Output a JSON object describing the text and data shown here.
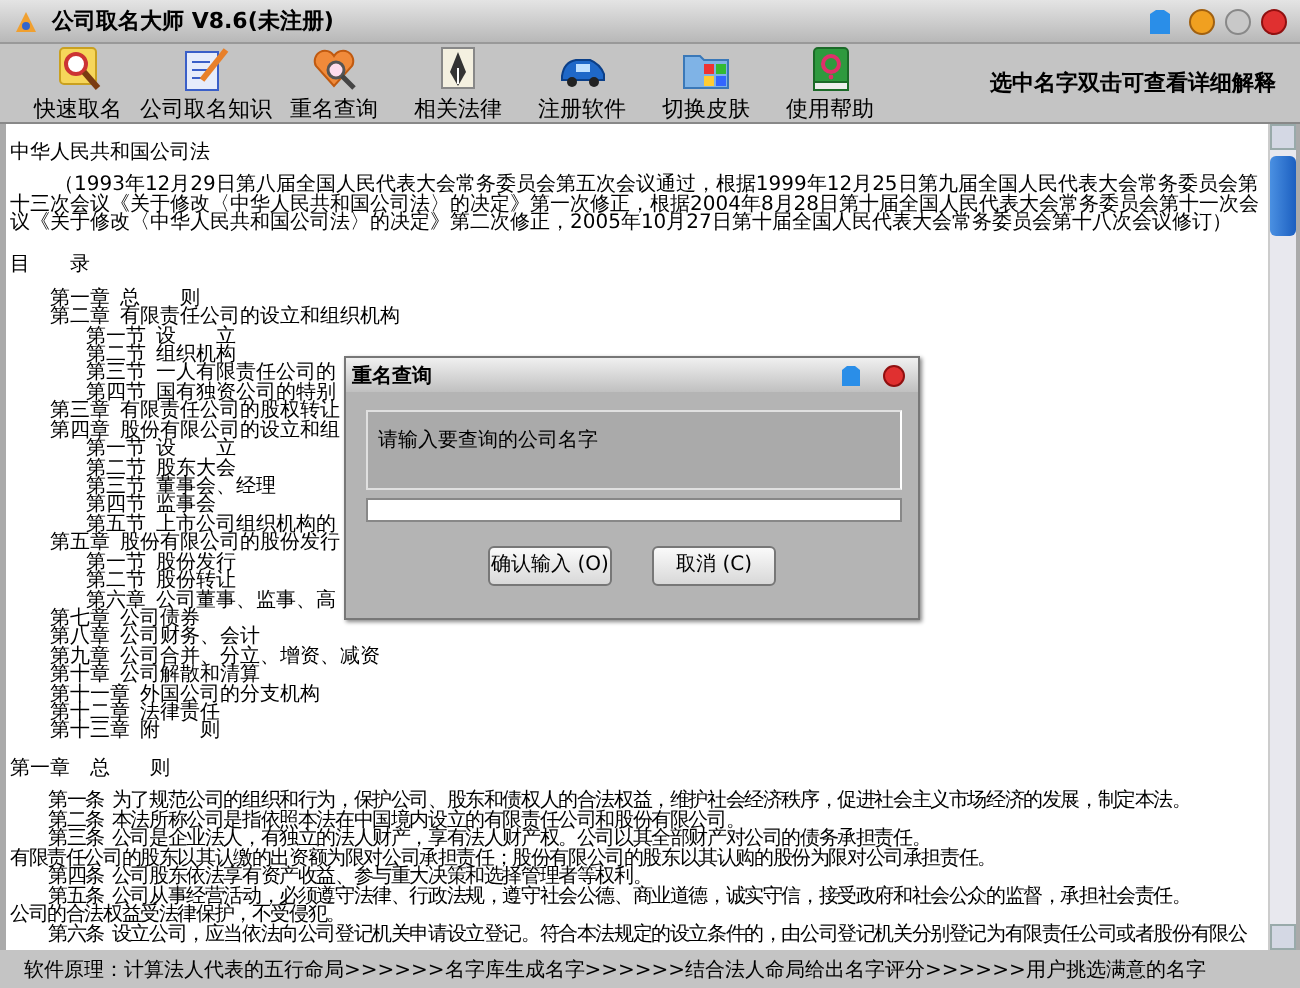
{
  "window": {
    "title": "公司取名大师 V8.6(未注册)"
  },
  "toolbar": {
    "buttons": [
      {
        "label": "快速取名"
      },
      {
        "label": "公司取名知识"
      },
      {
        "label": "重名查询"
      },
      {
        "label": "相关法律"
      },
      {
        "label": "注册软件"
      },
      {
        "label": "切换皮肤"
      },
      {
        "label": "使用帮助"
      }
    ],
    "hint": "选中名字双击可查看详细解释"
  },
  "document": {
    "title": "中华人民共和国公司法",
    "preamble": "（1993年12月29日第八届全国人民代表大会常务委员会第五次会议通过，根据1999年12月25日第九届全国人民代表大会常务委员会第十三次会议《关于修改〈中华人民共和国公司法〉的决定》第一次修正，根据2004年8月28日第十届全国人民代表大会常务委员会第十一次会议《关于修改〈中华人民共和国公司法〉的决定》第二次修正，2005年10月27日第十届全国人民代表大会常务委员会第十八次会议修订）",
    "toc_heading": "目　　录",
    "toc": [
      {
        "number": "第一章",
        "title": "总　　则"
      },
      {
        "number": "第二章",
        "title": "有限责任公司的设立和组织机构",
        "children": [
          {
            "number": "第一节",
            "title": "设　　立"
          },
          {
            "number": "第二节",
            "title": "组织机构"
          },
          {
            "number": "第三节",
            "title": "一人有限责任公司的"
          },
          {
            "number": "第四节",
            "title": "国有独资公司的特别"
          }
        ]
      },
      {
        "number": "第三章",
        "title": "有限责任公司的股权转让"
      },
      {
        "number": "第四章",
        "title": "股份有限公司的设立和组",
        "children": [
          {
            "number": "第一节",
            "title": "设　　立"
          },
          {
            "number": "第二节",
            "title": "股东大会"
          },
          {
            "number": "第三节",
            "title": "董事会、经理"
          },
          {
            "number": "第四节",
            "title": "监事会"
          },
          {
            "number": "第五节",
            "title": "上市公司组织机构的"
          }
        ]
      },
      {
        "number": "第五章",
        "title": "股份有限公司的股份发行",
        "children": [
          {
            "number": "第一节",
            "title": "股份发行"
          },
          {
            "number": "第二节",
            "title": "股份转让"
          },
          {
            "number": "第六章",
            "title": "公司董事、监事、高"
          }
        ]
      },
      {
        "number": "第七章",
        "title": "公司债券"
      },
      {
        "number": "第八章",
        "title": "公司财务、会计"
      },
      {
        "number": "第九章",
        "title": "公司合并、分立、增资、减资"
      },
      {
        "number": "第十章",
        "title": "公司解散和清算"
      },
      {
        "number": "第十一章",
        "title": "外国公司的分支机构"
      },
      {
        "number": "第十二章",
        "title": "法律责任"
      },
      {
        "number": "第十三章",
        "title": "附　　则"
      }
    ],
    "chapter_heading": "第一章　总　　则",
    "articles": [
      {
        "number": "第一条",
        "text": "为了规范公司的组织和行为，保护公司、股东和债权人的合法权益，维护社会经济秩序，促进社会主义市场经济的发展，制定本法。"
      },
      {
        "number": "第二条",
        "text": "本法所称公司是指依照本法在中国境内设立的有限责任公司和股份有限公司。"
      },
      {
        "number": "第三条",
        "text": "公司是企业法人，有独立的法人财产，享有法人财产权。公司以其全部财产对公司的债务承担责任。"
      },
      {
        "text": "有限责任公司的股东以其认缴的出资额为限对公司承担责任；股份有限公司的股东以其认购的股份为限对公司承担责任。"
      },
      {
        "number": "第四条",
        "text": "公司股东依法享有资产收益、参与重大决策和选择管理者等权利。"
      },
      {
        "number": "第五条",
        "text": "公司从事经营活动，必须遵守法律、行政法规，遵守社会公德、商业道德，诚实守信，接受政府和社会公众的监督，承担社会责任。"
      },
      {
        "text": "公司的合法权益受法律保护，不受侵犯。"
      },
      {
        "number": "第六条",
        "text": "设立公司，应当依法向公司登记机关申请设立登记。符合本法规定的设立条件的，由公司登记机关分别登记为有限责任公司或者股份有限公"
      }
    ]
  },
  "dialog": {
    "title": "重名查询",
    "prompt": "请输入要查询的公司名字",
    "buttons": [
      {
        "label": "确认输入 (O)"
      },
      {
        "label": "取消 (C)"
      }
    ]
  },
  "status_bar": "软件原理：计算法人代表的五行命局>>>>>>名字库生成名字>>>>>>结合法人命局给出名字评分>>>>>>用户挑选满意的名字"
}
